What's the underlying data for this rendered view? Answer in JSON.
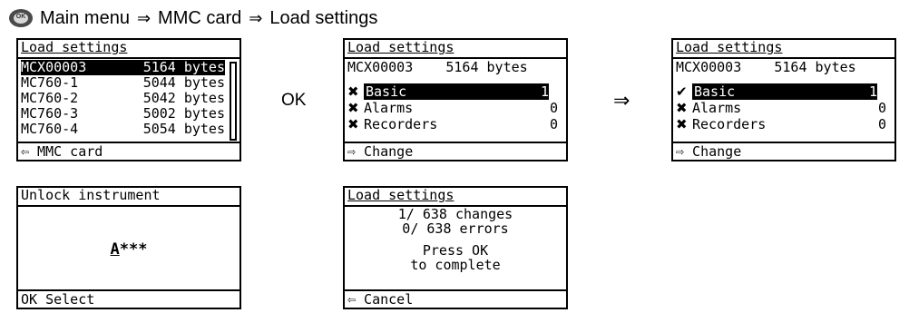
{
  "breadcrumb": {
    "icon": "ok-button-icon",
    "icon_text": "OK",
    "path": [
      "Main menu",
      "MMC card",
      "Load settings"
    ],
    "separator": "⇒"
  },
  "screen1": {
    "title": "Load settings",
    "files": [
      {
        "name": "MCX00003",
        "size": "5164 bytes",
        "selected": true
      },
      {
        "name": "MC760-1",
        "size": "5044 bytes"
      },
      {
        "name": "MC760-2",
        "size": "5042 bytes"
      },
      {
        "name": "MC760-3",
        "size": "5002 bytes"
      },
      {
        "name": "MC760-4",
        "size": "5054 bytes"
      }
    ],
    "footer": "⇦ MMC card"
  },
  "ok_label": "OK",
  "arrow_label": "⇒",
  "screen2": {
    "title": "Load settings",
    "file_line": "MCX00003    5164 bytes",
    "options": [
      {
        "mark": "✖",
        "label": "Basic",
        "value": "1",
        "highlight": true
      },
      {
        "mark": "✖",
        "label": "Alarms",
        "value": "0"
      },
      {
        "mark": "✖",
        "label": "Recorders",
        "value": "0"
      }
    ],
    "footer": "⇨ Change"
  },
  "screen3": {
    "title": "Load settings",
    "file_line": "MCX00003    5164 bytes",
    "options": [
      {
        "mark": "✔",
        "label": "Basic",
        "value": "1",
        "highlight": true
      },
      {
        "mark": "✖",
        "label": "Alarms",
        "value": "0"
      },
      {
        "mark": "✖",
        "label": "Recorders",
        "value": "0"
      }
    ],
    "footer": "⇨ Change"
  },
  "screen4": {
    "title": "Unlock instrument",
    "code_first": "A",
    "code_rest": "***",
    "footer": "OK Select"
  },
  "screen5": {
    "title": "Load settings",
    "line1": "1/ 638 changes",
    "line2": "0/ 638 errors",
    "line3": "Press OK",
    "line4": "to complete",
    "footer": "⇦ Cancel"
  }
}
